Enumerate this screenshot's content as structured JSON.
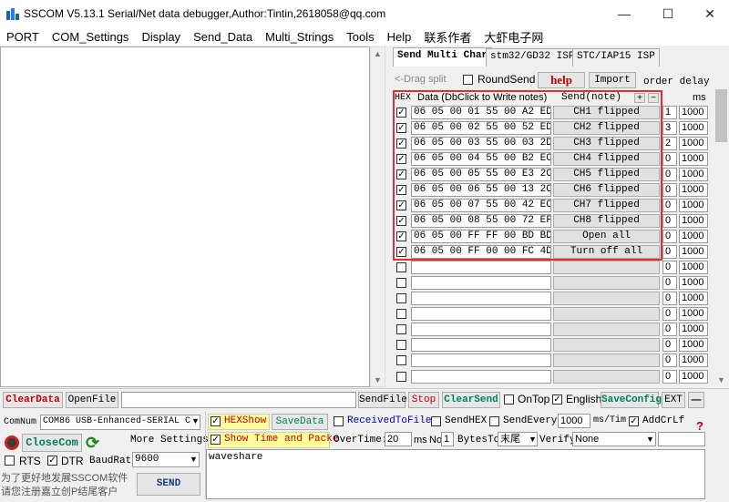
{
  "window": {
    "title": "SSCOM V5.13.1 Serial/Net data debugger,Author:Tintin,2618058@qq.com"
  },
  "menu": [
    "PORT",
    "COM_Settings",
    "Display",
    "Send_Data",
    "Multi_Strings",
    "Tools",
    "Help",
    "联系作者",
    "大虾电子网"
  ],
  "tabs": [
    "Send Multi Char",
    "stm32/GD32 ISP",
    "STC/IAP15 ISP"
  ],
  "multi": {
    "drag_split": "<-Drag split",
    "round_send": "RoundSend",
    "help": "help",
    "import": "Import",
    "order_delay": "order delay",
    "hex_col": "HEX",
    "data_col": "Data (DbClick to Write notes)",
    "send_col": "Send(note)",
    "plus": "+",
    "minus": "−",
    "ms_col": "ms",
    "rows": [
      {
        "checked": true,
        "data": "06 05 00 01 55 00 A2 ED",
        "note": "CH1 flipped",
        "order": "1",
        "delay": "1000"
      },
      {
        "checked": true,
        "data": "06 05 00 02 55 00 52 ED",
        "note": "CH2 flipped",
        "order": "3",
        "delay": "1000"
      },
      {
        "checked": true,
        "data": "06 05 00 03 55 00 03 2D",
        "note": "CH3 flipped",
        "order": "2",
        "delay": "1000"
      },
      {
        "checked": true,
        "data": "06 05 00 04 55 00 B2 EC",
        "note": "CH4 flipped",
        "order": "0",
        "delay": "1000"
      },
      {
        "checked": true,
        "data": "06 05 00 05 55 00 E3 2C",
        "note": "CH5 flipped",
        "order": "0",
        "delay": "1000"
      },
      {
        "checked": true,
        "data": "06 05 00 06 55 00 13 2C",
        "note": "CH6 flipped",
        "order": "0",
        "delay": "1000"
      },
      {
        "checked": true,
        "data": "06 05 00 07 55 00 42 EC",
        "note": "CH7 flipped",
        "order": "0",
        "delay": "1000"
      },
      {
        "checked": true,
        "data": "06 05 00 08 55 00 72 EF",
        "note": "CH8 flipped",
        "order": "0",
        "delay": "1000"
      },
      {
        "checked": true,
        "data": "06 05 00 FF FF 00 BD BD",
        "note": "Open all",
        "order": "0",
        "delay": "1000"
      },
      {
        "checked": true,
        "data": "06 05 00 FF 00 00 FC 4D",
        "note": "Turn off all",
        "order": "0",
        "delay": "1000"
      },
      {
        "checked": false,
        "data": "",
        "note": "",
        "order": "0",
        "delay": "1000"
      },
      {
        "checked": false,
        "data": "",
        "note": "",
        "order": "0",
        "delay": "1000"
      },
      {
        "checked": false,
        "data": "",
        "note": "",
        "order": "0",
        "delay": "1000"
      },
      {
        "checked": false,
        "data": "",
        "note": "",
        "order": "0",
        "delay": "1000"
      },
      {
        "checked": false,
        "data": "",
        "note": "",
        "order": "0",
        "delay": "1000"
      },
      {
        "checked": false,
        "data": "",
        "note": "",
        "order": "0",
        "delay": "1000"
      },
      {
        "checked": false,
        "data": "",
        "note": "",
        "order": "0",
        "delay": "1000"
      },
      {
        "checked": false,
        "data": "",
        "note": "",
        "order": "0",
        "delay": "1000"
      }
    ]
  },
  "toolbar": {
    "clear_data": "ClearData",
    "open_file": "OpenFile",
    "send_file": "SendFile",
    "stop": "Stop",
    "clear_send": "ClearSend",
    "on_top": "OnTop",
    "english": "English",
    "save_config": "SaveConfig",
    "ext": "EXT",
    "dash": "—"
  },
  "bottom": {
    "com_num_label": "ComNum",
    "com_port": "COM86 USB-Enhanced-SERIAL C",
    "close_com": "CloseCom",
    "more_settings": "More Settings",
    "rts": "RTS",
    "dtr": "DTR",
    "baud_label": "BaudRat",
    "baud": "9600",
    "hex_show": "HEXShow",
    "save_data": "SaveData",
    "received_to_file": "ReceivedToFile",
    "send_hex": "SendHEX",
    "send_every": "SendEvery:",
    "send_every_value": "1000",
    "ms_tim": "ms/Tim",
    "add_crlf": "AddCrLf",
    "question": "?",
    "show_time": "Show Time and Packe",
    "over_time": "OverTime:",
    "over_time_value": "20",
    "ms": "ms",
    "no": "No",
    "no_value": "1",
    "bytes_to": "BytesTo",
    "bytes_to_value": "末尾",
    "verify": "Verify",
    "verify_value": "None",
    "send_text": "waveshare",
    "promo": "为了更好地发展SSCOM软件\n请您注册嘉立创P结尾客户",
    "send": "SEND"
  }
}
